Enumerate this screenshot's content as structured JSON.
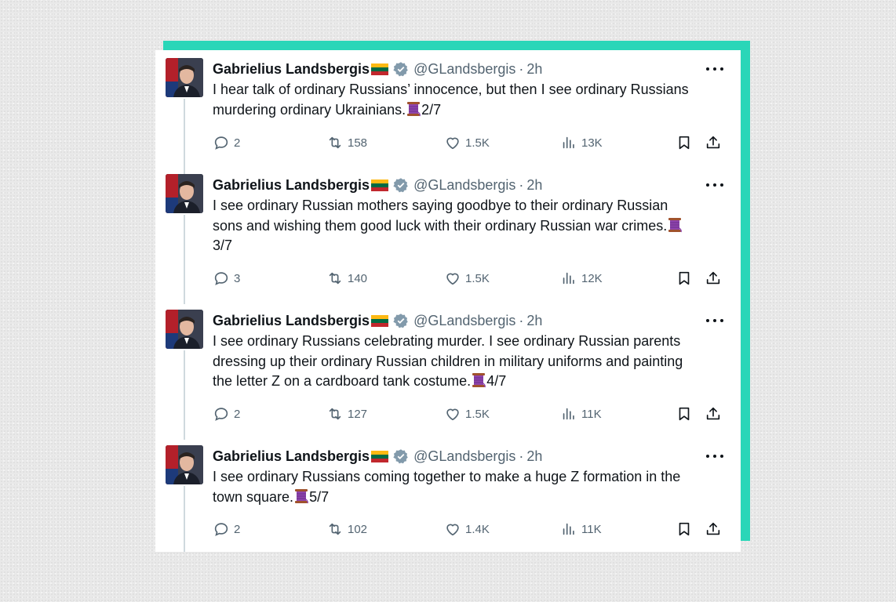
{
  "author": {
    "name": "Gabrielius Landsbergis",
    "handle": "@GLandsbergis",
    "time": "2h",
    "dot": "·"
  },
  "icons": {
    "flag": "lithuania-flag-icon",
    "verified": "verified-badge-icon",
    "thread": "spool-of-thread-emoji",
    "reply": "reply-icon",
    "retweet": "retweet-icon",
    "like": "heart-icon",
    "views": "views-chart-icon",
    "bookmark": "bookmark-icon",
    "share": "share-icon",
    "more": "more-options-icon"
  },
  "colors": {
    "accent_frame": "#2ad6b8",
    "text": "#0f1419",
    "muted": "#536471",
    "verified": "#829aab"
  },
  "tweets": [
    {
      "text": "I hear talk of ordinary Russians’ innocence, but then I see ordinary Russians\nmurdering ordinary Ukrainians.",
      "suffix": "2/7",
      "replies": "2",
      "retweets": "158",
      "likes": "1.5K",
      "views": "13K"
    },
    {
      "text": "I see ordinary Russian mothers saying goodbye to their ordinary Russian\nsons and wishing them good luck with their ordinary Russian war crimes.",
      "suffix": "3/7",
      "replies": "3",
      "retweets": "140",
      "likes": "1.5K",
      "views": "12K"
    },
    {
      "text": "I see ordinary Russians celebrating murder. I see ordinary Russian parents\ndressing up their ordinary Russian children in military uniforms and painting\nthe letter Z on a cardboard tank costume.",
      "suffix": "4/7",
      "replies": "2",
      "retweets": "127",
      "likes": "1.5K",
      "views": "11K"
    },
    {
      "text": "I see ordinary Russians coming together to make a huge Z formation in the\ntown square.",
      "suffix": "5/7",
      "replies": "2",
      "retweets": "102",
      "likes": "1.4K",
      "views": "11K"
    }
  ]
}
